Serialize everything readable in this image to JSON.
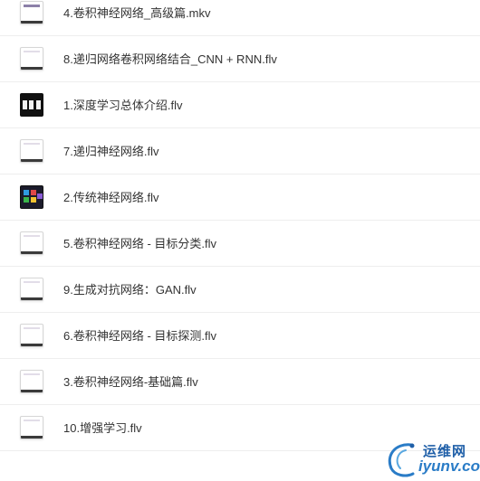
{
  "files": [
    {
      "name": "4.卷积神经网络_高级篇.mkv",
      "thumb": "blank-purple"
    },
    {
      "name": "8.递归网络卷积网络结合_CNN + RNN.flv",
      "thumb": "blank"
    },
    {
      "name": "1.深度学习总体介绍.flv",
      "thumb": "film"
    },
    {
      "name": "7.递归神经网络.flv",
      "thumb": "blank"
    },
    {
      "name": "2.传统神经网络.flv",
      "thumb": "dark"
    },
    {
      "name": "5.卷积神经网络 - 目标分类.flv",
      "thumb": "blank"
    },
    {
      "name": "9.生成对抗网络：GAN.flv",
      "thumb": "blank"
    },
    {
      "name": "6.卷积神经网络 - 目标探测.flv",
      "thumb": "blank"
    },
    {
      "name": "3.卷积神经网络-基础篇.flv",
      "thumb": "blank"
    },
    {
      "name": "10.增强学习.flv",
      "thumb": "blank"
    }
  ],
  "watermark": {
    "line1": "运维网",
    "line2": "iyunv.com"
  }
}
